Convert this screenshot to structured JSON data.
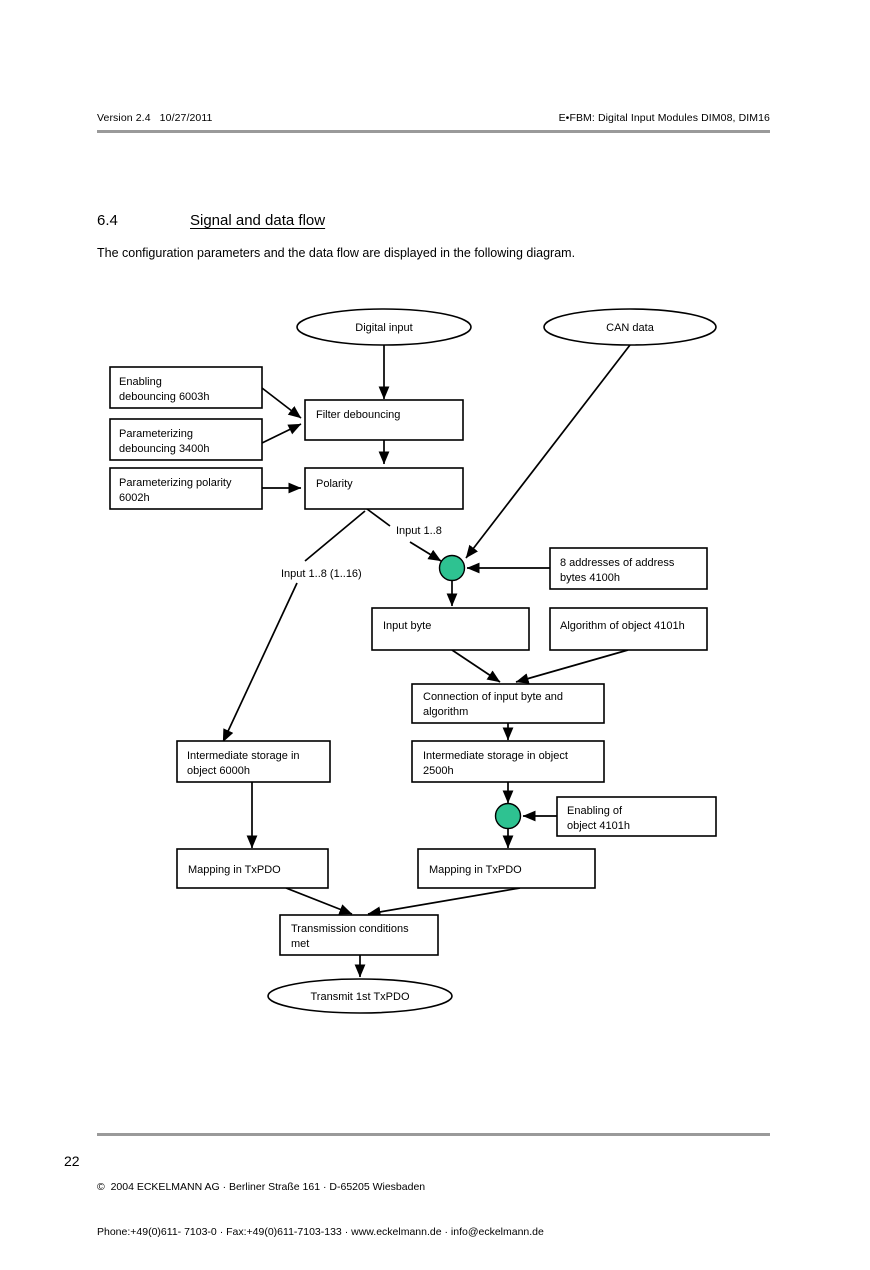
{
  "header": {
    "left": "Version 2.4   10/27/2011",
    "right": "E•FBM: Digital Input Modules DIM08, DIM16"
  },
  "section": {
    "number": "6.4",
    "title": "Signal and data flow",
    "intro": "The configuration parameters and the data flow are displayed in the following diagram."
  },
  "footer": {
    "page_number": "22",
    "line1": "©  2004 ECKELMANN AG · Berliner Straße 161 · D-65205 Wiesbaden",
    "line2": "Phone:+49(0)611- 7103-0 · Fax:+49(0)611-7103-133 · www.eckelmann.de · info@eckelmann.de"
  },
  "colors": {
    "junction_fill": "#2ec291",
    "rule": "#9a9a9a",
    "stroke": "#000000",
    "node_fill": "#ffffff"
  },
  "diagram": {
    "type": "flowchart",
    "nodes": [
      {
        "id": "digital_input",
        "shape": "ellipse",
        "label": "Digital input"
      },
      {
        "id": "can_data",
        "shape": "ellipse",
        "label": "CAN data"
      },
      {
        "id": "enabling_debouncing",
        "shape": "box",
        "line1": "Enabling",
        "line2": "debouncing  6003h"
      },
      {
        "id": "param_debouncing",
        "shape": "box",
        "line1": "Parameterizing",
        "line2": "debouncing  3400h"
      },
      {
        "id": "param_polarity",
        "shape": "box",
        "line1": "Parameterizing polarity",
        "line2": "6002h"
      },
      {
        "id": "filter_debouncing",
        "shape": "box",
        "line1": "Filter debouncing",
        "line2": ""
      },
      {
        "id": "polarity",
        "shape": "box",
        "line1": "Polarity",
        "line2": ""
      },
      {
        "id": "addresses",
        "shape": "box",
        "line1": "8 addresses of address",
        "line2": "bytes 4100h"
      },
      {
        "id": "input_byte",
        "shape": "box",
        "line1": "Input byte",
        "line2": ""
      },
      {
        "id": "algorithm",
        "shape": "box",
        "line1": "Algorithm of object 4101h",
        "line2": ""
      },
      {
        "id": "connection",
        "shape": "box",
        "line1": "Connection of input byte and",
        "line2": "algorithm"
      },
      {
        "id": "storage_6000h",
        "shape": "box",
        "line1": "Intermediate storage in",
        "line2": "object 6000h"
      },
      {
        "id": "storage_2500h",
        "shape": "box",
        "line1": "Intermediate storage in object",
        "line2": "2500h"
      },
      {
        "id": "enabling_4101h",
        "shape": "box",
        "line1": "Enabling of",
        "line2": "object 4101h"
      },
      {
        "id": "mapping_left",
        "shape": "box",
        "line1": "Mapping in TxPDO",
        "line2": ""
      },
      {
        "id": "mapping_right",
        "shape": "box",
        "line1": "Mapping in TxPDO",
        "line2": ""
      },
      {
        "id": "transmission",
        "shape": "box",
        "line1": "Transmission conditions",
        "line2": "met"
      },
      {
        "id": "transmit",
        "shape": "ellipse",
        "label": "Transmit 1st TxPDO"
      },
      {
        "id": "junction_top",
        "shape": "junction",
        "label": ""
      },
      {
        "id": "junction_bottom",
        "shape": "junction",
        "label": ""
      }
    ],
    "edge_labels": [
      {
        "id": "input_1_8",
        "text": "Input 1..8"
      },
      {
        "id": "input_1_8_1_16",
        "text": "Input 1..8 (1..16)"
      }
    ]
  }
}
